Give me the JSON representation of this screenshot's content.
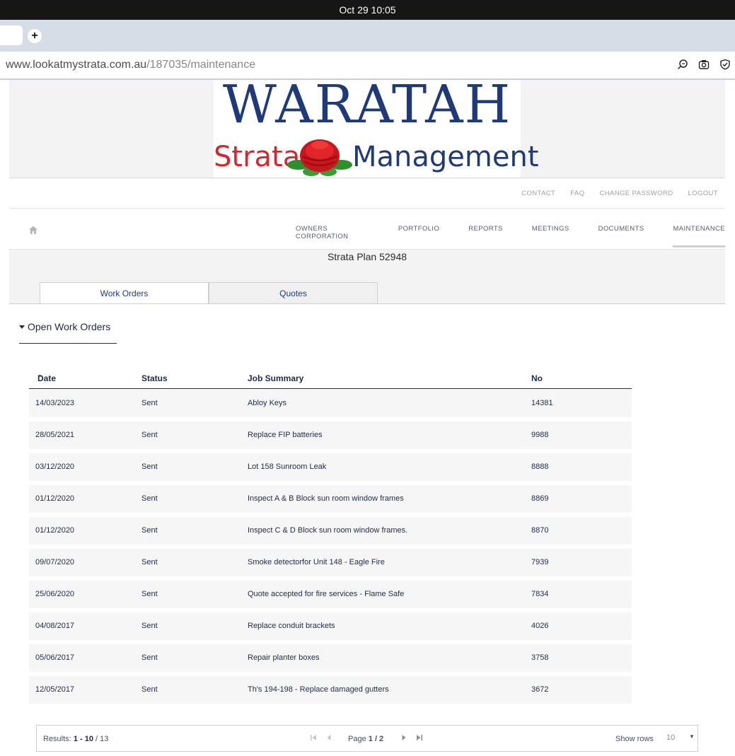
{
  "os": {
    "datetime": "Oct 29  10:05"
  },
  "browser": {
    "new_tab": "+",
    "url_domain": "www.lookatmystrata.com.au",
    "url_path": "/187035/maintenance"
  },
  "logo": {
    "word": "WARATAH",
    "strata": "Strata",
    "management": "Management"
  },
  "util_nav": [
    "CONTACT",
    "FAQ",
    "CHANGE PASSWORD",
    "LOGOUT"
  ],
  "main_nav": [
    "OWNERS CORPORATION",
    "PORTFOLIO",
    "REPORTS",
    "MEETINGS",
    "DOCUMENTS",
    "MAINTENANCE"
  ],
  "plan_title": "Strata Plan 52948",
  "tabs": [
    "Work Orders",
    "Quotes"
  ],
  "section_title": "Open Work Orders",
  "table": {
    "headers": {
      "date": "Date",
      "status": "Status",
      "summary": "Job Summary",
      "no": "No"
    },
    "rows": [
      {
        "date": "14/03/2023",
        "status": "Sent",
        "summary": "Abloy Keys",
        "no": "14381"
      },
      {
        "date": "28/05/2021",
        "status": "Sent",
        "summary": "Replace FIP batteries",
        "no": "9988"
      },
      {
        "date": "03/12/2020",
        "status": "Sent",
        "summary": "Lot 158 Sunroom Leak",
        "no": "8888"
      },
      {
        "date": "01/12/2020",
        "status": "Sent",
        "summary": "Inspect A & B Block sun room window frames",
        "no": "8869"
      },
      {
        "date": "01/12/2020",
        "status": "Sent",
        "summary": "Inspect C & D Block sun room window frames.",
        "no": "8870"
      },
      {
        "date": "09/07/2020",
        "status": "Sent",
        "summary": "Smoke detectorfor Unit 148 - Eagle Fire",
        "no": "7939"
      },
      {
        "date": "25/06/2020",
        "status": "Sent",
        "summary": "Quote accepted for fire services - Flame Safe",
        "no": "7834"
      },
      {
        "date": "04/08/2017",
        "status": "Sent",
        "summary": "Replace conduit brackets",
        "no": "4026"
      },
      {
        "date": "05/06/2017",
        "status": "Sent",
        "summary": "Repair planter boxes",
        "no": "3758"
      },
      {
        "date": "12/05/2017",
        "status": "Sent",
        "summary": "Th's 194-198 - Replace damaged gutters",
        "no": "3672"
      }
    ]
  },
  "pager": {
    "results_label": "Results:",
    "results_range": "1 - 10",
    "results_total": "/ 13",
    "page_label": "Page",
    "page_value": "1 / 2",
    "show_rows_label": "Show rows",
    "show_rows_value": "10"
  }
}
